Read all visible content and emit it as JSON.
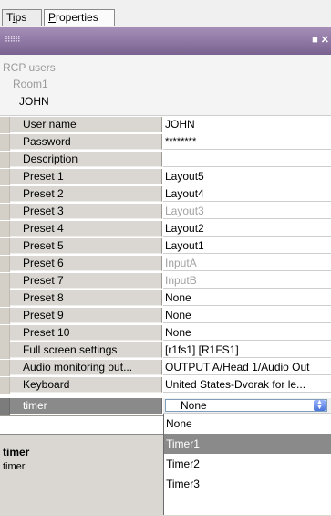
{
  "tabs": [
    {
      "label": "Tips",
      "mnemonic": "i"
    },
    {
      "label": "Properties",
      "mnemonic": "P"
    }
  ],
  "panel": {
    "grip_icon": "grip-dots",
    "buttons": [
      "maximize-icon",
      "close-icon"
    ]
  },
  "tree": {
    "root": "RCP users",
    "room": "Room1",
    "user": "JOHN"
  },
  "properties": [
    {
      "key": "User name",
      "value": "JOHN",
      "style": "normal"
    },
    {
      "key": "Password",
      "value": "********",
      "style": "small"
    },
    {
      "key": "Description",
      "value": "",
      "style": "normal"
    },
    {
      "key": "Preset 1",
      "value": "Layout5",
      "style": "normal"
    },
    {
      "key": "Preset 2",
      "value": "Layout4",
      "style": "normal"
    },
    {
      "key": "Preset 3",
      "value": "Layout3",
      "style": "gray"
    },
    {
      "key": "Preset 4",
      "value": "Layout2",
      "style": "normal"
    },
    {
      "key": "Preset 5",
      "value": "Layout1",
      "style": "normal"
    },
    {
      "key": "Preset 6",
      "value": "InputA",
      "style": "gray"
    },
    {
      "key": "Preset 7",
      "value": "InputB",
      "style": "gray"
    },
    {
      "key": "Preset 8",
      "value": "None",
      "style": "normal"
    },
    {
      "key": "Preset 9",
      "value": "None",
      "style": "normal"
    },
    {
      "key": "Preset 10",
      "value": "None",
      "style": "normal"
    },
    {
      "key": "Full screen settings",
      "value": "[r1fs1] [R1FS1]",
      "style": "normal"
    },
    {
      "key": "Audio monitoring out...",
      "value": "OUTPUT A/Head 1/Audio Out",
      "style": "normal"
    },
    {
      "key": "Keyboard",
      "value": "United States-Dvorak for le...",
      "style": "normal"
    }
  ],
  "selected_row": {
    "key": "timer",
    "value": "None"
  },
  "dropdown_options": [
    "None",
    "Timer1",
    "Timer2",
    "Timer3"
  ],
  "dropdown_highlighted": "Timer1",
  "tips": {
    "title": "timer",
    "text": "timer"
  }
}
